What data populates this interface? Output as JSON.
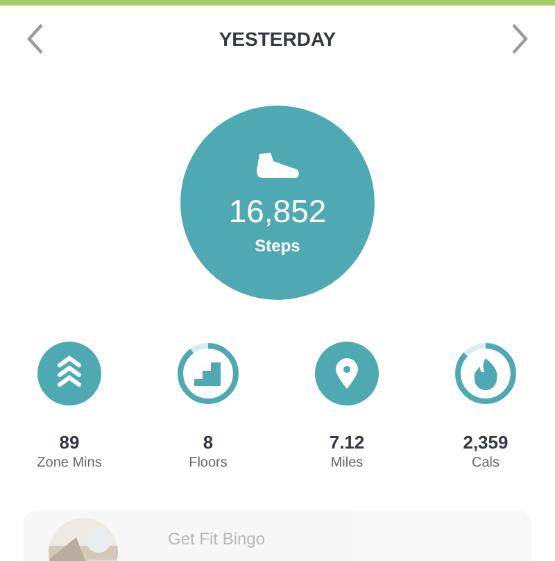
{
  "header": {
    "title": "YESTERDAY"
  },
  "steps": {
    "value": "16,852",
    "label": "Steps"
  },
  "stats": [
    {
      "kind": "filled",
      "value": "89",
      "label": "Zone Mins"
    },
    {
      "kind": "ring",
      "level": 0.9,
      "value": "8",
      "label": "Floors"
    },
    {
      "kind": "filled",
      "value": "7.12",
      "label": "Miles"
    },
    {
      "kind": "ring",
      "level": 0.87,
      "value": "2,359",
      "label": "Cals"
    }
  ],
  "card": {
    "title": "Get Fit Bingo"
  }
}
